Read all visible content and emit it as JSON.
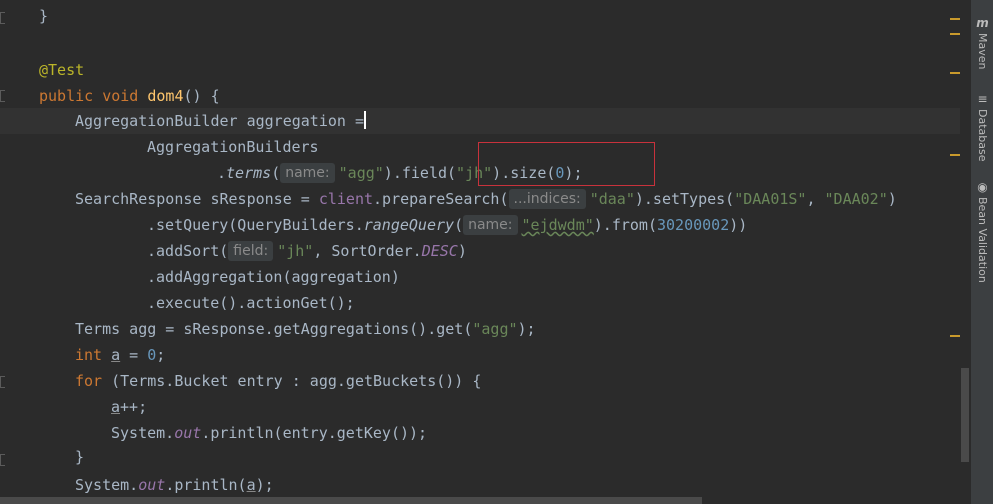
{
  "lines": {
    "l1": {
      "brace": "}"
    },
    "l3": {
      "annotation": "@Test"
    },
    "l4": {
      "kw1": "public",
      "kw2": "void",
      "name": "dom4",
      "rest": "() {"
    },
    "l5": {
      "type": "AggregationBuilder",
      "var": "aggregation",
      "op": " ="
    },
    "l6": {
      "text": "AggregationBuilders"
    },
    "l7": {
      "dot": ".",
      "method": "terms",
      "p1": "(",
      "hint": "name:",
      "str": "\"agg\"",
      "p2": ").field(",
      "str2": "\"jh\"",
      "p3": ").size(",
      "num": "0",
      "p4": ");"
    },
    "l8": {
      "a": "SearchResponse sResponse = ",
      "client": "client",
      "b": ".prepareSearch(",
      "hint": "...indices:",
      "str1": "\"daa\"",
      "c": ").setTypes(",
      "str2": "\"DAA01S\"",
      "d": ", ",
      "str3": "\"DAA02\"",
      "e": ")"
    },
    "l9": {
      "a": ".setQuery(QueryBuilders.",
      "method": "rangeQuery",
      "b": "(",
      "hint": "name:",
      "str": "\"ejdwdm\"",
      "c": ").from(",
      "num": "30200002",
      "d": "))"
    },
    "l10": {
      "a": ".addSort(",
      "hint": "field:",
      "str": "\"jh\"",
      "b": ", SortOrder.",
      "cst": "DESC",
      "c": ")"
    },
    "l11": {
      "text": ".addAggregation(aggregation)"
    },
    "l12": {
      "text": ".execute().actionGet();"
    },
    "l13": {
      "a": "Terms agg = sResponse.getAggregations().get(",
      "str": "\"agg\"",
      "b": ");"
    },
    "l14": {
      "kw": "int",
      "var": "a",
      "b": " = ",
      "num": "0",
      "c": ";"
    },
    "l15": {
      "kw": "for",
      "b": " (Terms.Bucket entry : agg.getBuckets()) {"
    },
    "l16": {
      "var": "a",
      "b": "++;"
    },
    "l17": {
      "a": "System.",
      "field": "out",
      "b": ".println(entry.getKey());"
    },
    "l18": {
      "brace": "}"
    },
    "l19": {
      "a": "System.",
      "field": "out",
      "b": ".println(",
      "var": "a",
      "c": ");"
    }
  },
  "toolwindows": [
    {
      "icon": "m",
      "label": "Maven",
      "icon_name": "maven-icon"
    },
    {
      "icon": "≡",
      "label": "Database",
      "icon_name": "database-icon"
    },
    {
      "icon": "◉",
      "label": "Bean Validation",
      "icon_name": "bean-validation-icon"
    }
  ],
  "colors": {
    "background": "#2b2b2b",
    "keyword": "#cc7832",
    "string": "#6a8759",
    "number": "#6897bb",
    "function": "#ffc66d",
    "annotation": "#bbb529",
    "highlight_box": "#c8323c"
  }
}
